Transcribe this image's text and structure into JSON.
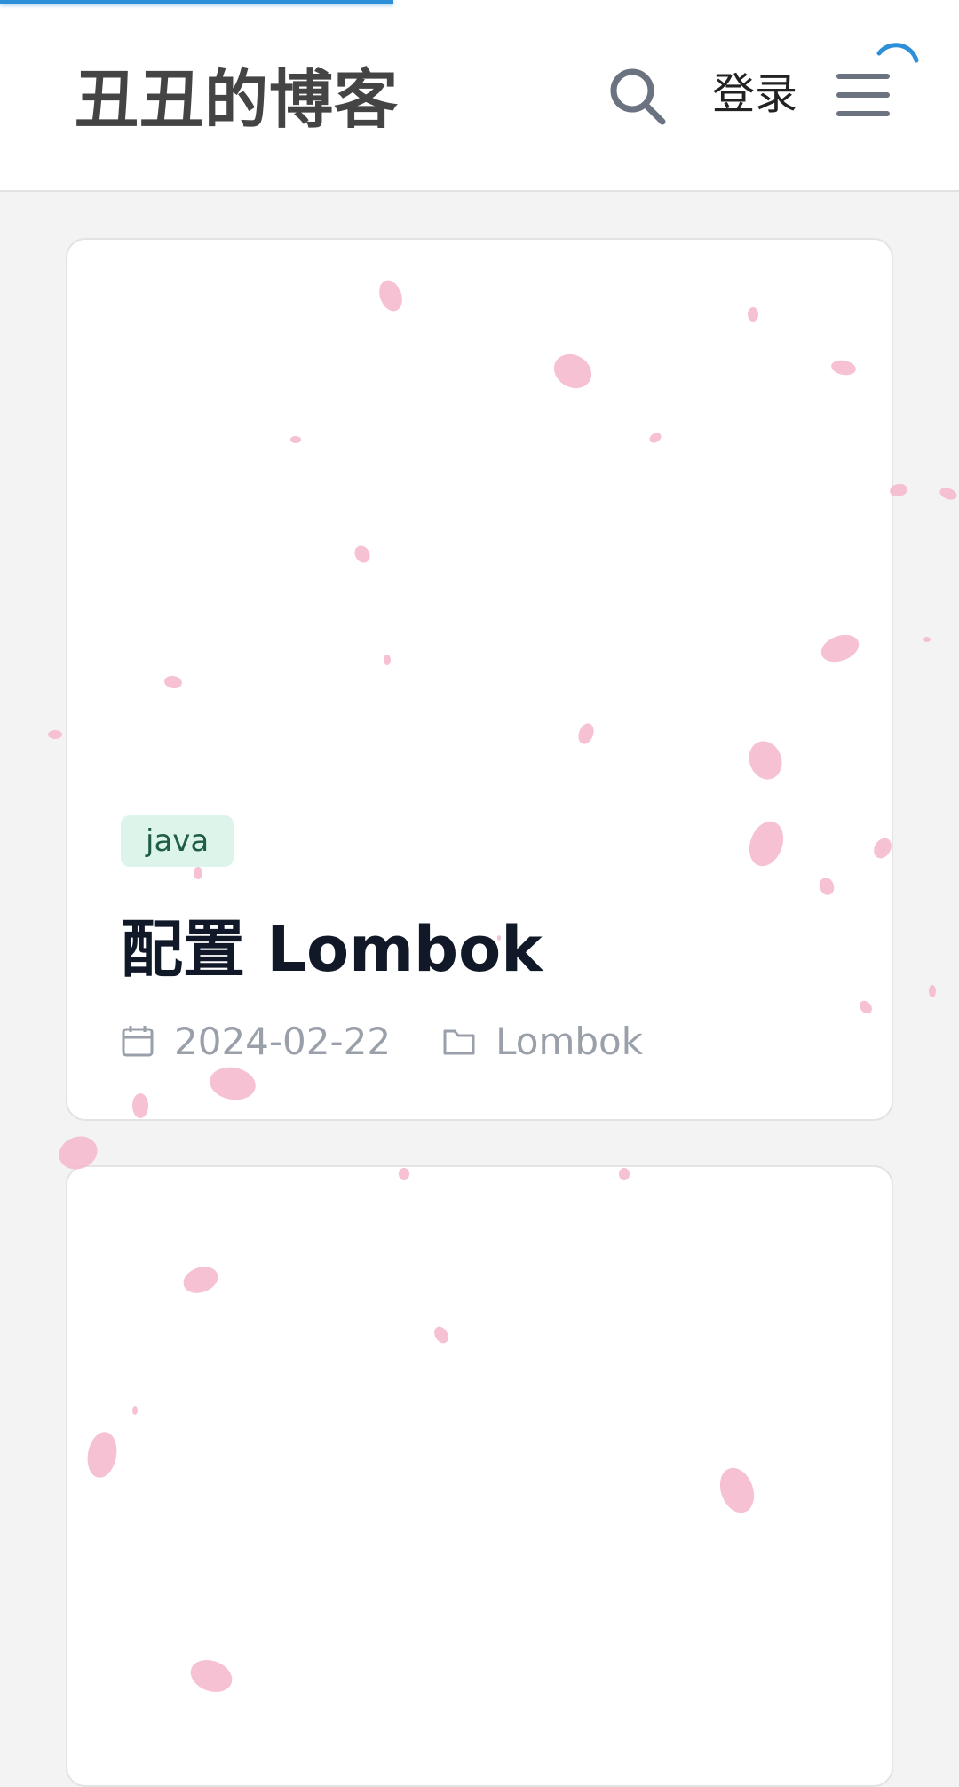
{
  "header": {
    "site_title": "丑丑的博客",
    "login_label": "登录"
  },
  "icons": {
    "search": "search-icon",
    "menu": "hamburger-menu-icon",
    "loading": "loading-spinner-icon",
    "calendar": "calendar-icon",
    "folder": "folder-icon"
  },
  "colors": {
    "accent": "#2d8fd8",
    "tag_bg": "#dcf4ea",
    "tag_text": "#1f5d47",
    "petal": "#f4b6cb"
  },
  "page_load_progress": 0.41,
  "posts": [
    {
      "tag": "java",
      "title": "配置 Lombok",
      "date": "2024-02-22",
      "category": "Lombok"
    }
  ]
}
